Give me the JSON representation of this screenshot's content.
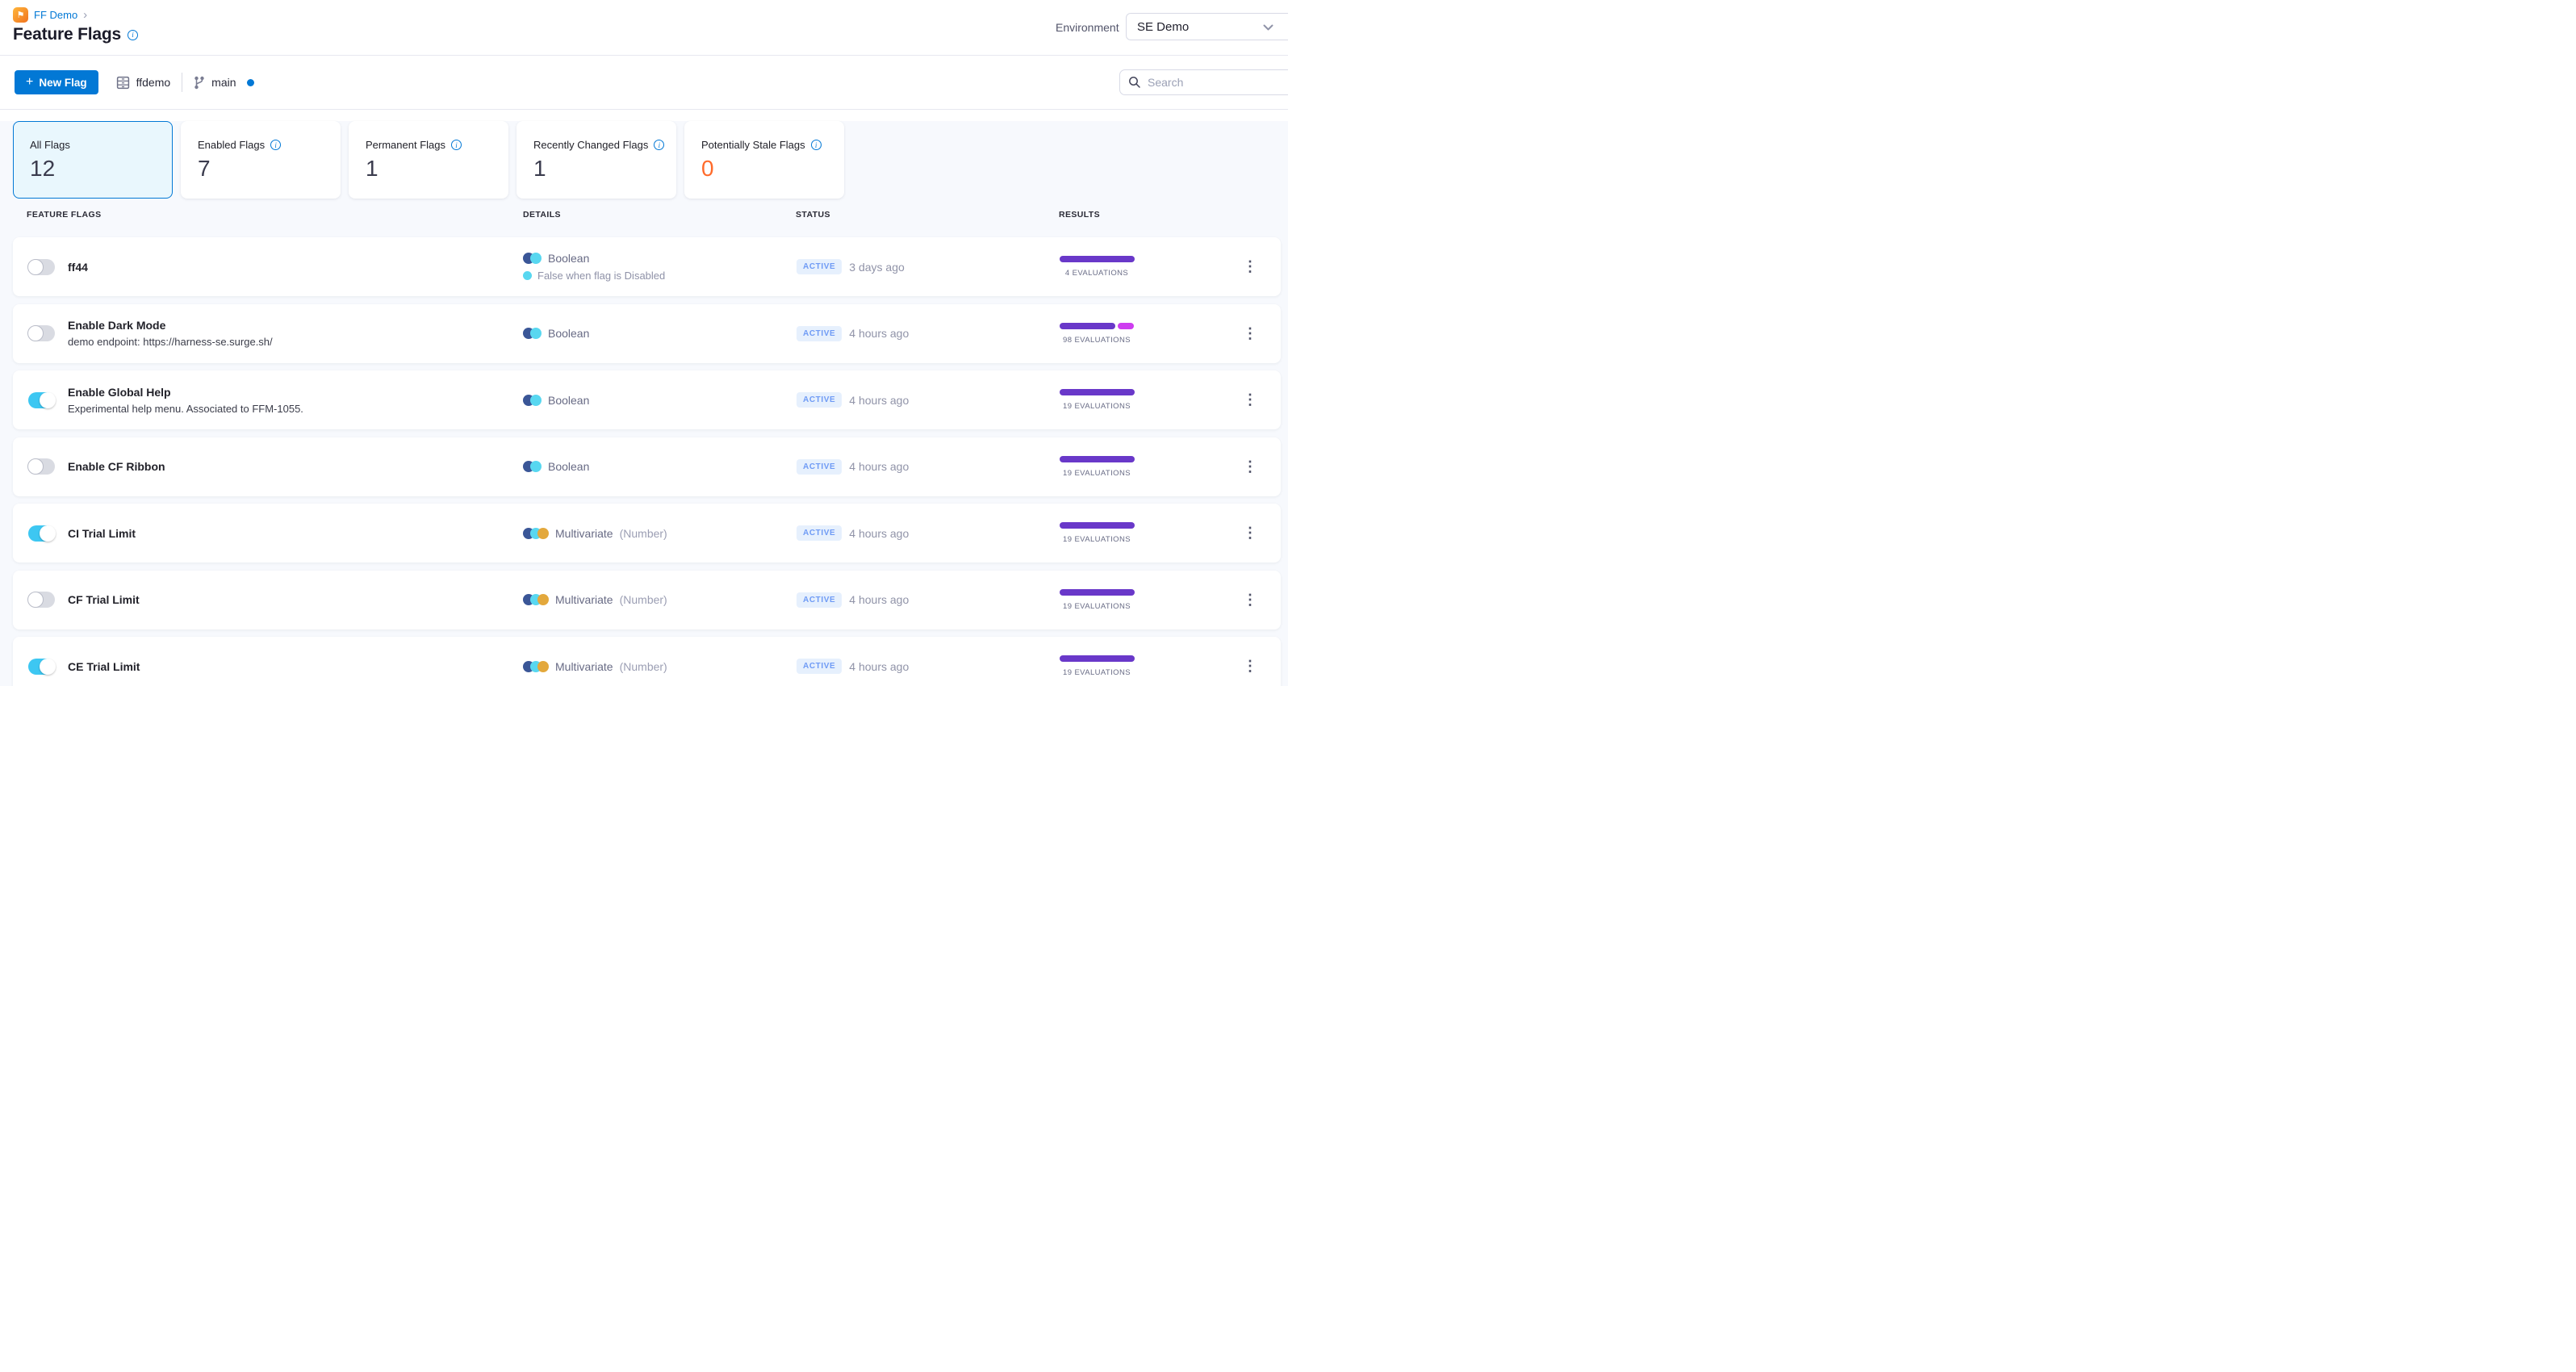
{
  "colors": {
    "primary_blue": "#0278d5",
    "toggle_on_cyan": "#3dc7f2",
    "bar_purple": "#6938c9",
    "bar_magenta": "#ce3df0",
    "stale_count_orange": "#ff6b2b",
    "active_badge_bg": "#e6f0fd",
    "active_badge_text": "#6f9bf5",
    "variation_navy": "#3a5697",
    "variation_cyan": "#58d7f0",
    "variation_gold": "#e3a83c"
  },
  "header": {
    "breadcrumb_project": "FF Demo",
    "title": "Feature Flags",
    "environment_label": "Environment",
    "environment_value": "SE Demo"
  },
  "toolbar": {
    "new_flag_label": "New Flag",
    "repo_name": "ffdemo",
    "branch_name": "main",
    "search_placeholder": "Search"
  },
  "filter_cards": [
    {
      "label": "All Flags",
      "count": "12",
      "selected": true,
      "has_info": false,
      "count_color": ""
    },
    {
      "label": "Enabled Flags",
      "count": "7",
      "selected": false,
      "has_info": true,
      "count_color": ""
    },
    {
      "label": "Permanent Flags",
      "count": "1",
      "selected": false,
      "has_info": true,
      "count_color": ""
    },
    {
      "label": "Recently Changed Flags",
      "count": "1",
      "selected": false,
      "has_info": true,
      "count_color": ""
    },
    {
      "label": "Potentially Stale Flags",
      "count": "0",
      "selected": false,
      "has_info": true,
      "count_color": "#ff6b2b"
    }
  ],
  "table": {
    "columns": {
      "flags": "FEATURE FLAGS",
      "details": "DETAILS",
      "status": "STATUS",
      "results": "RESULTS"
    },
    "rows": [
      {
        "name": "ff44",
        "subtitle": "",
        "enabled": false,
        "dots": [
          "#3a5697",
          "#58d7f0"
        ],
        "type_label": "Boolean",
        "type_note": "",
        "note": "False when flag is Disabled",
        "note_dot": "#58d7f0",
        "status": "ACTIVE",
        "time": "3 days ago",
        "evals": "4 EVALUATIONS",
        "segments": [
          {
            "color": "#6938c9",
            "pct": 100
          }
        ]
      },
      {
        "name": "Enable Dark Mode",
        "subtitle": "demo endpoint: https://harness-se.surge.sh/",
        "enabled": false,
        "dots": [
          "#3a5697",
          "#58d7f0"
        ],
        "type_label": "Boolean",
        "type_note": "",
        "note": "",
        "note_dot": "",
        "status": "ACTIVE",
        "time": "4 hours ago",
        "evals": "98 EVALUATIONS",
        "segments": [
          {
            "color": "#6938c9",
            "pct": 75
          },
          {
            "color": "#ce3df0",
            "pct": 21
          }
        ]
      },
      {
        "name": "Enable Global Help",
        "subtitle": "Experimental help menu. Associated to FFM-1055.",
        "enabled": true,
        "dots": [
          "#3a5697",
          "#58d7f0"
        ],
        "type_label": "Boolean",
        "type_note": "",
        "note": "",
        "note_dot": "",
        "status": "ACTIVE",
        "time": "4 hours ago",
        "evals": "19 EVALUATIONS",
        "segments": [
          {
            "color": "#6938c9",
            "pct": 100
          }
        ]
      },
      {
        "name": "Enable CF Ribbon",
        "subtitle": "",
        "enabled": false,
        "dots": [
          "#3a5697",
          "#58d7f0"
        ],
        "type_label": "Boolean",
        "type_note": "",
        "note": "",
        "note_dot": "",
        "status": "ACTIVE",
        "time": "4 hours ago",
        "evals": "19 EVALUATIONS",
        "segments": [
          {
            "color": "#6938c9",
            "pct": 100
          }
        ]
      },
      {
        "name": "CI Trial Limit",
        "subtitle": "",
        "enabled": true,
        "dots": [
          "#3a5697",
          "#58d7f0",
          "#e3a83c"
        ],
        "type_label": "Multivariate",
        "type_note": "(Number)",
        "note": "",
        "note_dot": "",
        "status": "ACTIVE",
        "time": "4 hours ago",
        "evals": "19 EVALUATIONS",
        "segments": [
          {
            "color": "#6938c9",
            "pct": 100
          }
        ]
      },
      {
        "name": "CF Trial Limit",
        "subtitle": "",
        "enabled": false,
        "dots": [
          "#3a5697",
          "#58d7f0",
          "#e3a83c"
        ],
        "type_label": "Multivariate",
        "type_note": "(Number)",
        "note": "",
        "note_dot": "",
        "status": "ACTIVE",
        "time": "4 hours ago",
        "evals": "19 EVALUATIONS",
        "segments": [
          {
            "color": "#6938c9",
            "pct": 100
          }
        ]
      },
      {
        "name": "CE Trial Limit",
        "subtitle": "",
        "enabled": true,
        "dots": [
          "#3a5697",
          "#58d7f0",
          "#e3a83c"
        ],
        "type_label": "Multivariate",
        "type_note": "(Number)",
        "note": "",
        "note_dot": "",
        "status": "ACTIVE",
        "time": "4 hours ago",
        "evals": "19 EVALUATIONS",
        "segments": [
          {
            "color": "#6938c9",
            "pct": 100
          }
        ]
      }
    ]
  }
}
